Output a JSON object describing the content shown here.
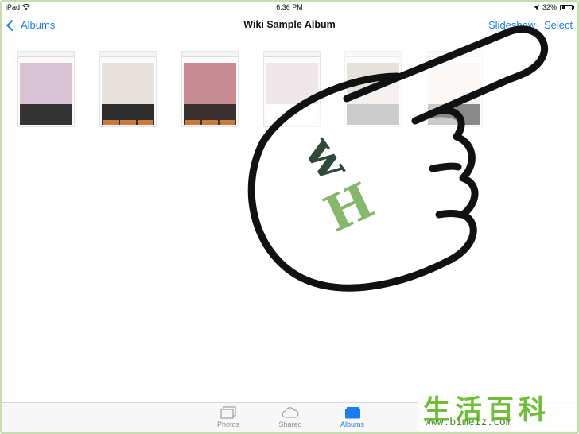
{
  "status_bar": {
    "device": "iPad",
    "time": "6:36 PM",
    "battery_text": "32%",
    "battery_level": 0.32
  },
  "nav": {
    "back_label": "Albums",
    "title": "Wiki Sample Album",
    "slideshow_label": "Slideshow",
    "select_label": "Select"
  },
  "thumbnails": [
    {
      "photo_color": "#d9c3d4",
      "cap_color": "#333333"
    },
    {
      "photo_color": "#e8e0da",
      "cap_color": "#2e2e2e"
    },
    {
      "photo_color": "#c78c93",
      "cap_color": "#3a3030"
    },
    {
      "photo_color": "#efe6ea",
      "cap_color": "#ffffff"
    },
    {
      "photo_color": "#cfc8c0",
      "cap_color": "#303030"
    },
    {
      "photo_color": "#eae8e4",
      "cap_color": "#2a2a2a"
    }
  ],
  "overlay": {
    "logo_letters": "wH",
    "logo_dark_color": "#2f4a38",
    "logo_light_color": "#86b86c"
  },
  "tab_bar": {
    "tabs": [
      {
        "label": "Photos",
        "icon": "photos-icon",
        "active": false
      },
      {
        "label": "Shared",
        "icon": "cloud-icon",
        "active": false
      },
      {
        "label": "Albums",
        "icon": "albums-icon",
        "active": true
      }
    ],
    "accent_color": "#1a7ef0"
  },
  "watermark": {
    "chars": "生活百科",
    "url": "www.bimeiz.com"
  }
}
